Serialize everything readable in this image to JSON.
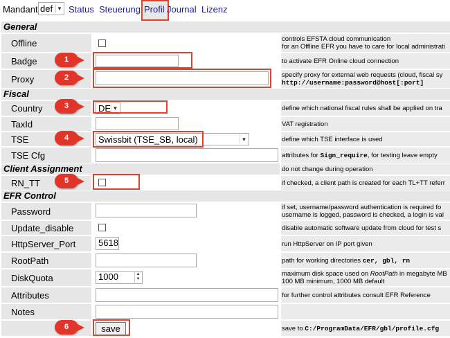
{
  "topbar": {
    "mandant_label": "Mandant",
    "mandant_value": "def",
    "nav": [
      "Status",
      "Steuerung",
      "Profil",
      "Journal",
      "Lizenz"
    ]
  },
  "sections": {
    "general": "General",
    "fiscal": "Fiscal",
    "client": "Client Assignment",
    "efr": "EFR Control"
  },
  "rows": {
    "offline": {
      "label": "Offline",
      "desc1": "controls EFSTA cloud communication",
      "desc2": "for an Offline EFR you have to care for local administrati"
    },
    "badge": {
      "label": "Badge",
      "value": "",
      "desc": "to activate EFR Online cloud connection"
    },
    "proxy": {
      "label": "Proxy",
      "value": "",
      "desc1": "specify proxy for external web requests (cloud, fiscal sy",
      "desc2": "http://username:password@host[:port]"
    },
    "country": {
      "label": "Country",
      "value": "DE",
      "desc": "define which national fiscal rules shall be applied on tra"
    },
    "taxid": {
      "label": "TaxId",
      "value": "",
      "desc": "VAT registration"
    },
    "tse": {
      "label": "TSE",
      "value": "Swissbit (TSE_SB, local)",
      "desc": "define which TSE interface is used"
    },
    "tsecfg": {
      "label": "TSE Cfg",
      "value": "",
      "desc_pre": "attributes for ",
      "desc_mono": "Sign_require",
      "desc_post": ", for testing leave empty"
    },
    "client_desc": "do not change during operation",
    "rntt": {
      "label": "RN_TT",
      "desc": "if checked, a client path is created for each TL+TT referr"
    },
    "password": {
      "label": "Password",
      "value": "",
      "desc1": "if set, username/password authentication is required fo",
      "desc2": "username is logged, password is checked, a login is val"
    },
    "update": {
      "label": "Update_disable",
      "desc": "disable automatic software update from cloud for test s"
    },
    "httpport": {
      "label": "HttpServer_Port",
      "value": "5618",
      "desc": "run HttpServer on IP port given"
    },
    "rootpath": {
      "label": "RootPath",
      "value": "",
      "desc_pre": "path for working directories ",
      "desc_mono": "cer, gbl, rn"
    },
    "diskquota": {
      "label": "DiskQuota",
      "value": "1000",
      "desc1_pre": "maximum disk space used on ",
      "desc1_it": "RootPath",
      "desc1_post": " in megabyte MB",
      "desc2": "100 MB minimum, 1000 MB default"
    },
    "attributes": {
      "label": "Attributes",
      "value": "",
      "desc": "for further control attributes consult EFR Reference"
    },
    "notes": {
      "label": "Notes",
      "value": ""
    },
    "save": {
      "label": "save",
      "desc_pre": "save to ",
      "desc_mono": "C:/ProgramData/EFR/gbl/profile.cfg"
    }
  },
  "callouts": [
    "1",
    "2",
    "3",
    "4",
    "5",
    "6"
  ],
  "colors": {
    "callout_red": "#e2352a",
    "link_blue": "#1a1aa6",
    "label_bg": "#e6e6e6"
  }
}
